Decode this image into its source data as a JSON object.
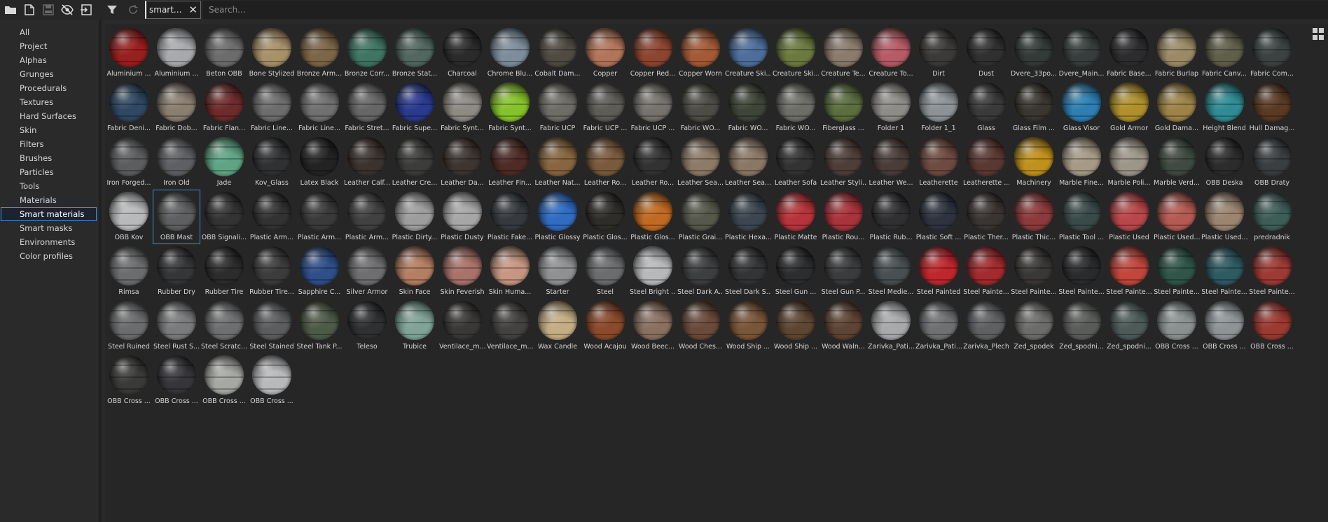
{
  "toolbar": {
    "icons": [
      "folder-icon",
      "new-document-icon",
      "save-icon",
      "hide-icon",
      "import-icon"
    ],
    "filter_chip_label": "smart...",
    "search_placeholder": "Search..."
  },
  "sidebar": {
    "items": [
      {
        "label": "All"
      },
      {
        "label": "Project"
      },
      {
        "label": "Alphas"
      },
      {
        "label": "Grunges"
      },
      {
        "label": "Procedurals"
      },
      {
        "label": "Textures"
      },
      {
        "label": "Hard Surfaces"
      },
      {
        "label": "Skin"
      },
      {
        "label": "Filters"
      },
      {
        "label": "Brushes"
      },
      {
        "label": "Particles"
      },
      {
        "label": "Tools"
      },
      {
        "label": "Materials"
      },
      {
        "label": "Smart materials",
        "active": true
      },
      {
        "label": "Smart masks"
      },
      {
        "label": "Environments"
      },
      {
        "label": "Color profiles"
      }
    ]
  },
  "colors": {
    "accent": "#3a8ee6"
  },
  "materials": [
    {
      "label": "Aluminium ...",
      "color": "#9a1f1f"
    },
    {
      "label": "Aluminium ...",
      "color": "#a7a9ac"
    },
    {
      "label": "Beton OBB",
      "color": "#6c6c6c"
    },
    {
      "label": "Bone Stylized",
      "color": "#a89068"
    },
    {
      "label": "Bronze Arm...",
      "color": "#7d6547"
    },
    {
      "label": "Bronze Corr...",
      "color": "#3f7562"
    },
    {
      "label": "Bronze Stat...",
      "color": "#52675f"
    },
    {
      "label": "Charcoal",
      "color": "#2b2b2b"
    },
    {
      "label": "Chrome Blu...",
      "color": "#7d8d9b"
    },
    {
      "label": "Cobalt Dam...",
      "color": "#4f4b43"
    },
    {
      "label": "Copper",
      "color": "#b3755a"
    },
    {
      "label": "Copper Red...",
      "color": "#8e4530"
    },
    {
      "label": "Copper Worn",
      "color": "#a35a35"
    },
    {
      "label": "Creature Ski...",
      "color": "#4d6e9b"
    },
    {
      "label": "Creature Ski...",
      "color": "#6c7a3f"
    },
    {
      "label": "Creature Te...",
      "color": "#8a7b6c"
    },
    {
      "label": "Creature To...",
      "color": "#b75b66"
    },
    {
      "label": "Dirt",
      "color": "#3c3a38"
    },
    {
      "label": "Dust",
      "color": "#303030"
    },
    {
      "label": "Dvere_33po...",
      "color": "#333a37"
    },
    {
      "label": "Dvere_Main...",
      "color": "#373d3c"
    },
    {
      "label": "Fabric Base...",
      "color": "#2c2c2e"
    },
    {
      "label": "Fabric Burlap",
      "color": "#9b8a66"
    },
    {
      "label": "Fabric Canv...",
      "color": "#5f5f4a"
    },
    {
      "label": "Fabric Com...",
      "color": "#3c4242"
    },
    {
      "label": "Fabric Deni...",
      "color": "#2f4863"
    },
    {
      "label": "Fabric Dob...",
      "color": "#8a7e70"
    },
    {
      "label": "Fabric Flan...",
      "color": "#6e2b2b"
    },
    {
      "label": "Fabric Line...",
      "color": "#6d6d6d"
    },
    {
      "label": "Fabric Line...",
      "color": "#707070"
    },
    {
      "label": "Fabric Stret...",
      "color": "#666666"
    },
    {
      "label": "Fabric Supe...",
      "color": "#2a3a8f"
    },
    {
      "label": "Fabric Synt...",
      "color": "#8e8a84"
    },
    {
      "label": "Fabric Synt...",
      "color": "#86c22a"
    },
    {
      "label": "Fabric UCP",
      "color": "#6e6c66"
    },
    {
      "label": "Fabric UCP ...",
      "color": "#5d5c57"
    },
    {
      "label": "Fabric UCP ...",
      "color": "#75736c"
    },
    {
      "label": "Fabric WO...",
      "color": "#4d4d45"
    },
    {
      "label": "Fabric WO...",
      "color": "#3f4538"
    },
    {
      "label": "Fabric WO...",
      "color": "#6e6e69"
    },
    {
      "label": "Fiberglass ...",
      "color": "#5b6e3e"
    },
    {
      "label": "Folder 1",
      "color": "#8e8c88"
    },
    {
      "label": "Folder 1_1",
      "color": "#8c9296"
    },
    {
      "label": "Glass",
      "color": "#3a3a3a"
    },
    {
      "label": "Glass Film ...",
      "color": "#3a3630"
    },
    {
      "label": "Glass Visor",
      "color": "#2d7fb3"
    },
    {
      "label": "Gold Armor",
      "color": "#b0902c"
    },
    {
      "label": "Gold Dama...",
      "color": "#9d8348"
    },
    {
      "label": "Height Blend",
      "color": "#2f8c95"
    },
    {
      "label": "Hull Damag...",
      "color": "#5a3a24"
    },
    {
      "label": "Iron Forged...",
      "color": "#5b5d5e"
    },
    {
      "label": "Iron Old",
      "color": "#5e5f62"
    },
    {
      "label": "Jade",
      "color": "#5fa585"
    },
    {
      "label": "Kov_Glass",
      "color": "#2f3133"
    },
    {
      "label": "Latex Black",
      "color": "#232323"
    },
    {
      "label": "Leather Calf...",
      "color": "#3a3330"
    },
    {
      "label": "Leather Cre...",
      "color": "#3c3c3a"
    },
    {
      "label": "Leather Da...",
      "color": "#3c3532"
    },
    {
      "label": "Leather Fin...",
      "color": "#4e2b26"
    },
    {
      "label": "Leather Nat...",
      "color": "#87653f"
    },
    {
      "label": "Leather Ro...",
      "color": "#7a5a3d"
    },
    {
      "label": "Leather Ro...",
      "color": "#323232"
    },
    {
      "label": "Leather Sea...",
      "color": "#8d7a67"
    },
    {
      "label": "Leather Sea...",
      "color": "#8a7766"
    },
    {
      "label": "Leather Sofa",
      "color": "#333333"
    },
    {
      "label": "Leather Styli...",
      "color": "#4e3e38"
    },
    {
      "label": "Leather We...",
      "color": "#4a3c38"
    },
    {
      "label": "Leatherette",
      "color": "#6e4a40"
    },
    {
      "label": "Leatherette ...",
      "color": "#5a3832"
    },
    {
      "label": "Machinery",
      "color": "#c0901c"
    },
    {
      "label": "Marble Fine...",
      "color": "#a69a86"
    },
    {
      "label": "Marble Poli...",
      "color": "#9c9688"
    },
    {
      "label": "Marble Verd...",
      "color": "#3f4a42"
    },
    {
      "label": "OBB Deska",
      "color": "#2c2c2c"
    },
    {
      "label": "OBB Draty",
      "color": "#3b3e40"
    },
    {
      "label": "OBB Kov",
      "color": "#b8b9bb"
    },
    {
      "label": "OBB Mast",
      "color": "#5e5f60",
      "selected": true
    },
    {
      "label": "OBB Signali...",
      "color": "#333333"
    },
    {
      "label": "Plastic Arm...",
      "color": "#323232"
    },
    {
      "label": "Plastic Arm...",
      "color": "#3a3a3a"
    },
    {
      "label": "Plastic Arm...",
      "color": "#414141"
    },
    {
      "label": "Plastic Dirty...",
      "color": "#9d9d9d"
    },
    {
      "label": "Plastic Dusty",
      "color": "#a6a6a6"
    },
    {
      "label": "Plastic Fake...",
      "color": "#363a3e"
    },
    {
      "label": "Plastic Glossy",
      "color": "#2f6cc2"
    },
    {
      "label": "Plastic Glos...",
      "color": "#2f2d2a"
    },
    {
      "label": "Plastic Glos...",
      "color": "#c06a22"
    },
    {
      "label": "Plastic Grai...",
      "color": "#55584a"
    },
    {
      "label": "Plastic Hexa...",
      "color": "#3b4650"
    },
    {
      "label": "Plastic Matte",
      "color": "#b7343a"
    },
    {
      "label": "Plastic Rou...",
      "color": "#a8333b"
    },
    {
      "label": "Plastic Rub...",
      "color": "#303033"
    },
    {
      "label": "Plastic Soft ...",
      "color": "#2f3340"
    },
    {
      "label": "Plastic Ther...",
      "color": "#3a3533"
    },
    {
      "label": "Plastic Thic...",
      "color": "#8d3a3c"
    },
    {
      "label": "Plastic Tool ...",
      "color": "#3a4a48"
    },
    {
      "label": "Plastic Used",
      "color": "#b8474b"
    },
    {
      "label": "Plastic Used...",
      "color": "#b35a52"
    },
    {
      "label": "Plastic Used...",
      "color": "#9b8470"
    },
    {
      "label": "predradnik",
      "color": "#3f5d57"
    },
    {
      "label": "Rimsa",
      "color": "#6c6d6e"
    },
    {
      "label": "Rubber Dry",
      "color": "#353638"
    },
    {
      "label": "Rubber Tire",
      "color": "#2c2c2c"
    },
    {
      "label": "Rubber Tire...",
      "color": "#3c3c3c"
    },
    {
      "label": "Sapphire C...",
      "color": "#2f4f8a"
    },
    {
      "label": "Silver Armor",
      "color": "#6e6e70"
    },
    {
      "label": "Skin Face",
      "color": "#b47e62"
    },
    {
      "label": "Skin Feverish",
      "color": "#a8726a"
    },
    {
      "label": "Skin Huma...",
      "color": "#c79682"
    },
    {
      "label": "Starter",
      "color": "#8e9092"
    },
    {
      "label": "Steel",
      "color": "#6a6c6e"
    },
    {
      "label": "Steel Bright ...",
      "color": "#b6b8ba"
    },
    {
      "label": "Steel Dark A...",
      "color": "#3d3e3f"
    },
    {
      "label": "Steel Dark S...",
      "color": "#333435"
    },
    {
      "label": "Steel Gun ...",
      "color": "#2c2d2e"
    },
    {
      "label": "Steel Gun P...",
      "color": "#3a3b3c"
    },
    {
      "label": "Steel Medie...",
      "color": "#495051"
    },
    {
      "label": "Steel Painted",
      "color": "#c0272d"
    },
    {
      "label": "Steel Painte...",
      "color": "#a32a2e"
    },
    {
      "label": "Steel Painte...",
      "color": "#3a3836"
    },
    {
      "label": "Steel Painte...",
      "color": "#2a2b2d"
    },
    {
      "label": "Steel Painte...",
      "color": "#c1463c"
    },
    {
      "label": "Steel Painte...",
      "color": "#2f5648"
    },
    {
      "label": "Steel Painte...",
      "color": "#2e5a62"
    },
    {
      "label": "Steel Painte...",
      "color": "#9e3a34"
    },
    {
      "label": "Steel Ruined",
      "color": "#6b6c6d"
    },
    {
      "label": "Steel Rust S...",
      "color": "#7a7b7c"
    },
    {
      "label": "Steel Scratc...",
      "color": "#6e6f70"
    },
    {
      "label": "Steel Stained",
      "color": "#5b5d5e"
    },
    {
      "label": "Steel Tank P...",
      "color": "#4e5a48"
    },
    {
      "label": "Teleso",
      "color": "#2e3032"
    },
    {
      "label": "Trubice",
      "color": "#7fa396"
    },
    {
      "label": "Ventilace_m...",
      "color": "#3a3836"
    },
    {
      "label": "Ventilace_m...",
      "color": "#444240"
    },
    {
      "label": "Wax Candle",
      "color": "#c4ad85"
    },
    {
      "label": "Wood Acajou",
      "color": "#8a4a2c"
    },
    {
      "label": "Wood Beec...",
      "color": "#8a7060"
    },
    {
      "label": "Wood Ches...",
      "color": "#6a4a3a"
    },
    {
      "label": "Wood Ship ...",
      "color": "#7a5638"
    },
    {
      "label": "Wood Ship ...",
      "color": "#5e4632"
    },
    {
      "label": "Wood Waln...",
      "color": "#5e4434"
    },
    {
      "label": "Zarivka_Pati...",
      "color": "#a7a9ab"
    },
    {
      "label": "Zarivka_Pati...",
      "color": "#6e7072"
    },
    {
      "label": "Zarivka_Plech",
      "color": "#5e6062"
    },
    {
      "label": "Zed_spodek",
      "color": "#6c6c6a"
    },
    {
      "label": "Zed_spodni...",
      "color": "#5a5c5a"
    },
    {
      "label": "Zed_spodni...",
      "color": "#4c5a58"
    },
    {
      "label": "ÖBB Cross ...",
      "color": "#8a9090"
    },
    {
      "label": "ÖBB Cross ...",
      "color": "#8e9496"
    },
    {
      "label": "ÖBB Cross ...",
      "color": "#9a3a30"
    },
    {
      "label": "ÖBB Cross ...",
      "color": "#3a3a38"
    },
    {
      "label": "ÖBB Cross ...",
      "color": "#36363a"
    },
    {
      "label": "ÖBB Cross ...",
      "color": "#a6a8a4"
    },
    {
      "label": "ÖBB Cross ...",
      "color": "#b8b9bb"
    }
  ]
}
